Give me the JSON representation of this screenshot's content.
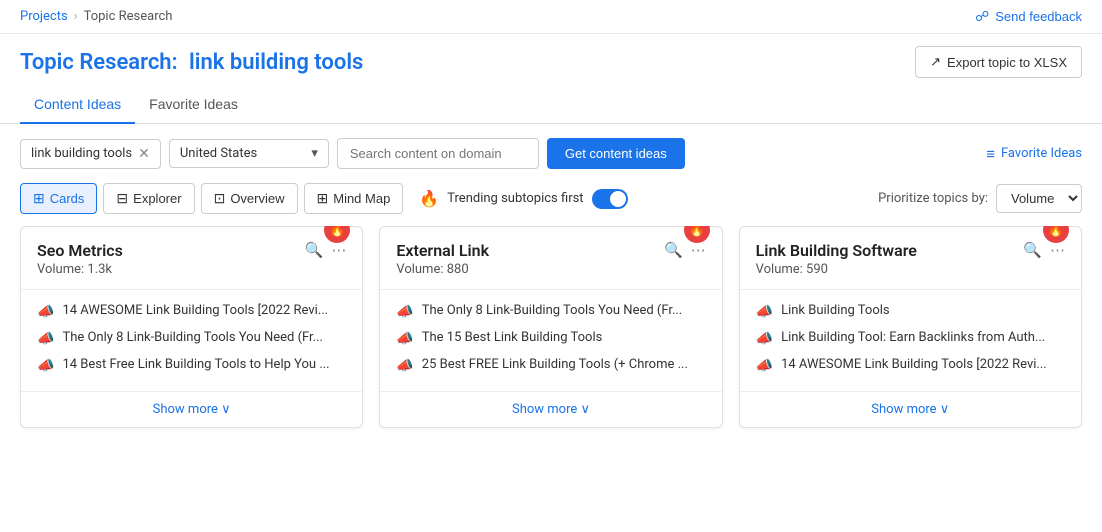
{
  "breadcrumb": {
    "parent": "Projects",
    "separator": "›",
    "current": "Topic Research"
  },
  "header": {
    "title_static": "Topic Research:",
    "title_dynamic": "link building tools",
    "export_label": "Export topic to XLSX",
    "send_feedback_label": "Send feedback"
  },
  "tabs": [
    {
      "id": "content-ideas",
      "label": "Content Ideas",
      "active": true
    },
    {
      "id": "favorite-ideas",
      "label": "Favorite Ideas",
      "active": false
    }
  ],
  "controls": {
    "search_tag": "link building tools",
    "country": "United States",
    "domain_placeholder": "Search content on domain",
    "get_ideas_label": "Get content ideas",
    "fav_ideas_label": "Favorite Ideas"
  },
  "view_buttons": [
    {
      "id": "cards",
      "label": "Cards",
      "active": true,
      "icon": "cards-icon"
    },
    {
      "id": "explorer",
      "label": "Explorer",
      "active": false,
      "icon": "table-icon"
    },
    {
      "id": "overview",
      "label": "Overview",
      "active": false,
      "icon": "overview-icon"
    },
    {
      "id": "mind-map",
      "label": "Mind Map",
      "active": false,
      "icon": "mindmap-icon"
    }
  ],
  "trending": {
    "label": "Trending subtopics first",
    "enabled": true
  },
  "prioritize": {
    "label": "Prioritize topics by:",
    "value": "Volume"
  },
  "cards": [
    {
      "id": "seo-metrics",
      "title": "Seo Metrics",
      "volume": "Volume: 1.3k",
      "trending": true,
      "links": [
        "14 AWESOME Link Building Tools [2022 Revi...",
        "The Only 8 Link-Building Tools You Need (Fr...",
        "14 Best Free Link Building Tools to Help You ..."
      ],
      "show_more": "Show more ∨"
    },
    {
      "id": "external-link",
      "title": "External Link",
      "volume": "Volume: 880",
      "trending": true,
      "links": [
        "The Only 8 Link-Building Tools You Need (Fr...",
        "The 15 Best Link Building Tools",
        "25 Best FREE Link Building Tools (+ Chrome ..."
      ],
      "show_more": "Show more ∨"
    },
    {
      "id": "link-building-software",
      "title": "Link Building Software",
      "volume": "Volume: 590",
      "trending": true,
      "links": [
        "Link Building Tools",
        "Link Building Tool: Earn Backlinks from Auth...",
        "14 AWESOME Link Building Tools [2022 Revi..."
      ],
      "show_more": "Show more ∨"
    }
  ],
  "icons": {
    "fire": "🔥",
    "megaphone": "📣",
    "search": "🔍",
    "dots": "⋯",
    "cards_icon": "⊞",
    "table_icon": "⊟",
    "overview_icon": "⊡",
    "mindmap_icon": "⊞",
    "export_icon": "↑",
    "feedback_icon": "◻",
    "chevron_down": "▾",
    "close": "✕",
    "list_icon": "≡",
    "show_more_chevron": "∨"
  }
}
